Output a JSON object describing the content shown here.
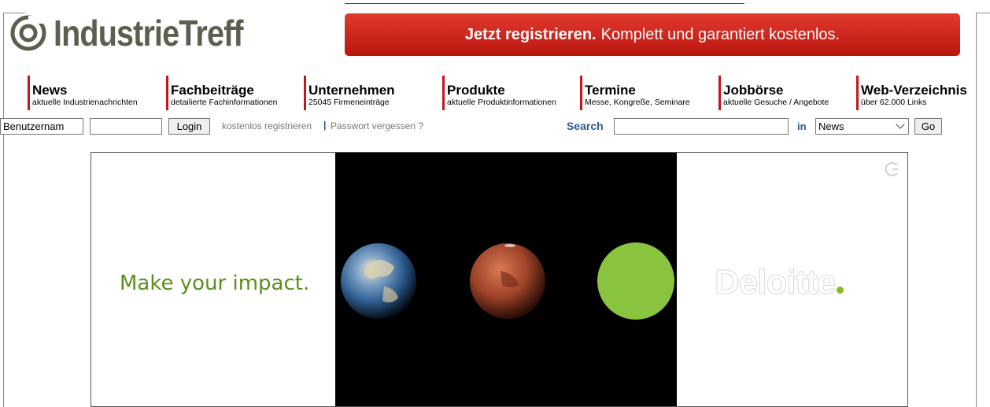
{
  "site": {
    "logo_text": "IndustrieTreff"
  },
  "register_banner": {
    "bold": "Jetzt registrieren.",
    "text": "Komplett und garantiert kostenlos."
  },
  "nav": {
    "items": [
      {
        "title": "News",
        "subtitle": "aktuelle Industrienachrichten"
      },
      {
        "title": "Fachbeiträge",
        "subtitle": "detailierte Fachinformationen"
      },
      {
        "title": "Unternehmen",
        "subtitle": "25045 Firmeneinträge"
      },
      {
        "title": "Produkte",
        "subtitle": "aktuelle Produktinformationen"
      },
      {
        "title": "Termine",
        "subtitle": "Messe, Kongreße, Seminare"
      },
      {
        "title": "Jobbörse",
        "subtitle": "aktuelle Gesuche / Angebote"
      },
      {
        "title": "Web-Verzeichnis",
        "subtitle": "über 62.000 Links"
      }
    ]
  },
  "login": {
    "username_value": "Benutzernam",
    "password_value": "",
    "login_label": "Login",
    "register_link": "kostenlos registrieren",
    "separator": "|",
    "forgot_link": "Passwort vergessen ?"
  },
  "search": {
    "label": "Search",
    "value": "",
    "in_label": "in",
    "scope_selected": "News",
    "go_label": "Go"
  },
  "ad": {
    "tagline": "Make your impact.",
    "brand": "Deloitte",
    "colors": {
      "green": "#86bc25",
      "tagline": "#5a8f1a"
    }
  },
  "colors": {
    "nav_accent": "#c4161c",
    "banner": "#d4281f",
    "search_blue": "#2d5a8e"
  }
}
